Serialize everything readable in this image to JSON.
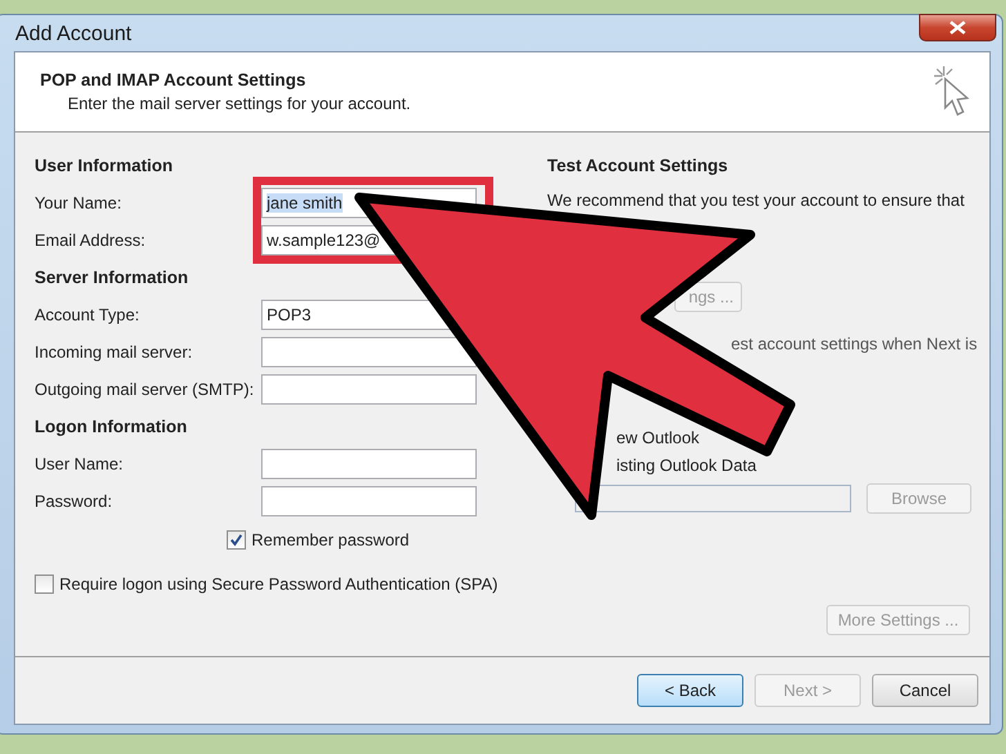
{
  "window": {
    "title": "Add Account"
  },
  "header": {
    "title": "POP and IMAP Account Settings",
    "subtitle": "Enter the mail server settings for your account."
  },
  "sections": [
    {
      "heading": "User Information",
      "fields": [
        {
          "label": "Your Name:",
          "value": "jane smith",
          "text_selected": true
        },
        {
          "label": "Email Address:",
          "value": "w.sample123@"
        }
      ]
    },
    {
      "heading": "Server Information",
      "fields": [
        {
          "label": "Account Type:",
          "value": "POP3"
        },
        {
          "label": "Incoming mail server:"
        },
        {
          "label": "Outgoing mail server (SMTP):"
        }
      ]
    },
    {
      "heading": "Logon Information",
      "fields": [
        {
          "label": "User Name:"
        },
        {
          "label": "Password:"
        }
      ]
    }
  ],
  "remember_password": {
    "label": "Remember password",
    "checked": true
  },
  "spa": {
    "label": "Require logon using Secure Password Authentication (SPA)",
    "checked": false
  },
  "test_settings": {
    "heading": "Test Account Settings",
    "text": "We recommend that you test your account to ensure that",
    "button": {
      "label": "ngs ...",
      "disabled": true
    },
    "fragments": [
      "est account settings when Next is",
      "ew Outlook",
      "isting Outlook Data"
    ],
    "browse": {
      "label": "Browse",
      "disabled": true
    }
  },
  "more_settings": {
    "label": "More Settings ...",
    "disabled": true
  },
  "buttons": [
    {
      "label": "< Back",
      "focused": true,
      "disabled": false
    },
    {
      "label": "Next >",
      "focused": false,
      "disabled": true
    },
    {
      "label": "Cancel",
      "focused": false,
      "disabled": false
    }
  ]
}
